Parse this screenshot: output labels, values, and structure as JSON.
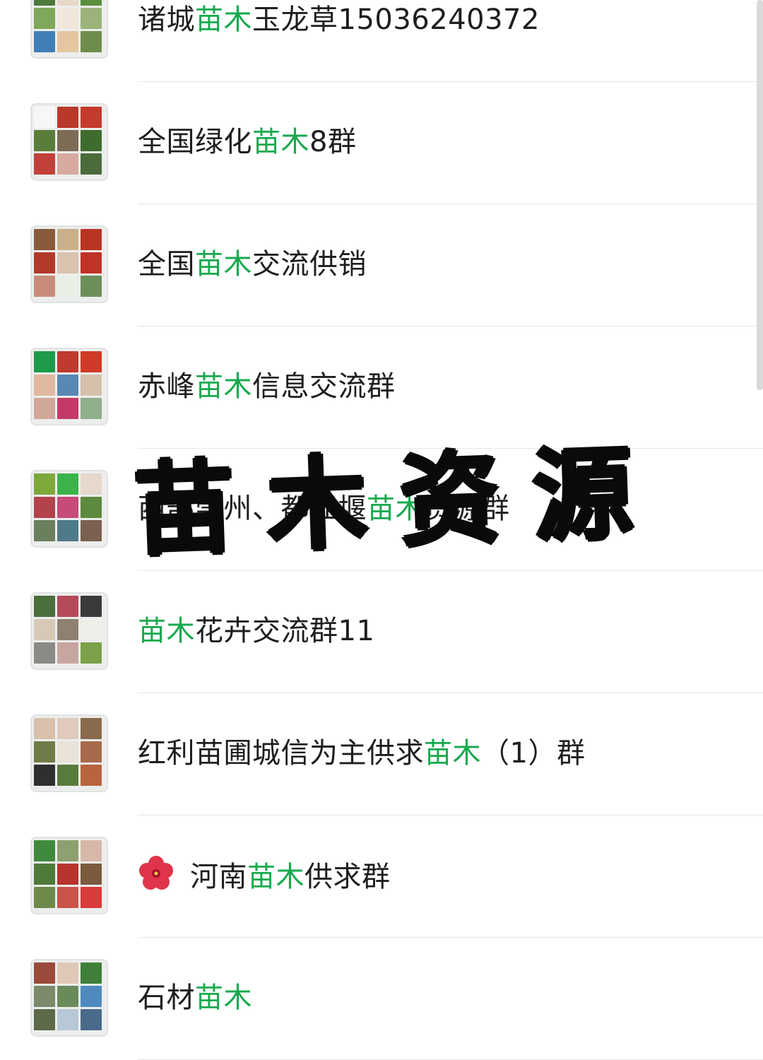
{
  "groups": [
    {
      "before": "诸城",
      "highlight": "苗木",
      "after": "玉龙草15036240372",
      "emoji": ""
    },
    {
      "before": "全国绿化",
      "highlight": "苗木",
      "after": "8群",
      "emoji": ""
    },
    {
      "before": "全国",
      "highlight": "苗木",
      "after": "交流供销",
      "emoji": ""
    },
    {
      "before": "赤峰",
      "highlight": "苗木",
      "after": "信息交流群",
      "emoji": ""
    },
    {
      "before": "西部崇州、都江堰",
      "highlight": "苗木",
      "after": "资源群",
      "emoji": ""
    },
    {
      "before": "",
      "highlight": "苗木",
      "after": "花卉交流群11",
      "emoji": ""
    },
    {
      "before": "红利苗圃城信为主供求",
      "highlight": "苗木",
      "after": "（1）群",
      "emoji": ""
    },
    {
      "before": "",
      "highlight": "苗木",
      "after": "供求群",
      "emoji": "hibiscus",
      "prefix": "河南"
    },
    {
      "before": "石材",
      "highlight": "苗木",
      "after": "",
      "emoji": ""
    }
  ],
  "overlay_text": "苗木资源",
  "colors": {
    "highlight": "#17a94e",
    "text": "#1e1e1e",
    "divider": "#e6e6e6"
  },
  "avatar_palettes": [
    [
      "#4d7a3a",
      "#e8d8c8",
      "#5b8f3e",
      "#7fa85a",
      "#f1e6dc",
      "#9bb37a",
      "#3f7fb5",
      "#e5c6a0",
      "#6f8d4c"
    ],
    [
      "#f7f7f7",
      "#b8382a",
      "#c43b2d",
      "#5a7d3b",
      "#7d6b55",
      "#3e6b2e",
      "#c2403a",
      "#d8a9a0",
      "#4b6b3a"
    ],
    [
      "#8a5a3c",
      "#c9b08a",
      "#b83524",
      "#b33a2b",
      "#d9c2ae",
      "#c23226",
      "#c98c7a",
      "#e9efe4",
      "#6d8f5a"
    ],
    [
      "#1d9a4a",
      "#bf3b2f",
      "#d03a27",
      "#e0b8a0",
      "#5a88b4",
      "#d6c0ac",
      "#d1a898",
      "#c43a67",
      "#8fae8a"
    ],
    [
      "#7fa83a",
      "#3cb34a",
      "#e6d8cc",
      "#b4424a",
      "#c64a7a",
      "#5d8a3e",
      "#6a7f5c",
      "#4f7a8a",
      "#7a6050"
    ],
    [
      "#4a6e3c",
      "#b54a5a",
      "#3a3a3a",
      "#d8c8b8",
      "#8f8070",
      "#f0eee8",
      "#8a8a86",
      "#c8a6a0",
      "#7da04a"
    ],
    [
      "#d8c0aa",
      "#e0cabb",
      "#8a6a4c",
      "#6e7c48",
      "#e9e3d8",
      "#a86a4c",
      "#2f2f2f",
      "#5a7b3e",
      "#b8643e"
    ],
    [
      "#3f8a3e",
      "#8da070",
      "#d7b8a8",
      "#4e7a3a",
      "#b8342e",
      "#7b5a3e",
      "#6d8a4a",
      "#c9544a",
      "#d93a3a"
    ],
    [
      "#9a4a3a",
      "#e0c8b8",
      "#3f7f3a",
      "#7a8a6a",
      "#6a8a5a",
      "#4f8abf",
      "#5d6a4a",
      "#b8c8d8",
      "#4a6a8a"
    ]
  ]
}
